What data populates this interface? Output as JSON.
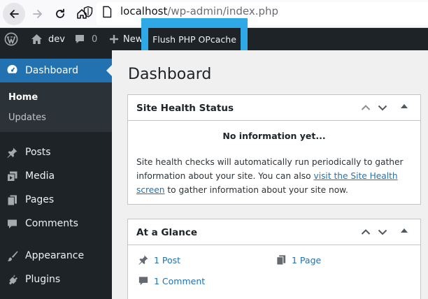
{
  "browser": {
    "url_host": "localhost",
    "url_path": "/wp-admin/index.php"
  },
  "adminbar": {
    "site_name": "dev",
    "comments_count": "0",
    "new_label": "New",
    "flush_label": "Flush PHP OPcache",
    "highlight_color": "#2fa8e6"
  },
  "sidebar": {
    "dashboard_label": "Dashboard",
    "submenu": {
      "home": "Home",
      "updates": "Updates"
    },
    "items": [
      {
        "label": "Posts",
        "icon": "pin-icon"
      },
      {
        "label": "Media",
        "icon": "media-icon"
      },
      {
        "label": "Pages",
        "icon": "pages-icon"
      },
      {
        "label": "Comments",
        "icon": "comment-icon"
      },
      {
        "label": "Appearance",
        "icon": "brush-icon"
      },
      {
        "label": "Plugins",
        "icon": "plug-icon"
      }
    ]
  },
  "main": {
    "title": "Dashboard",
    "site_health": {
      "title": "Site Health Status",
      "no_info": "No information yet...",
      "desc_before": "Site health checks will automatically run periodically to gather information about your site. You can also ",
      "link": "visit the Site Health screen",
      "desc_after": " to gather information about your site now."
    },
    "at_a_glance": {
      "title": "At a Glance",
      "posts": "1 Post",
      "pages": "1 Page",
      "comments": "1 Comment"
    }
  },
  "colors": {
    "accent": "#2271b1",
    "admin_bg": "#1d2327"
  }
}
